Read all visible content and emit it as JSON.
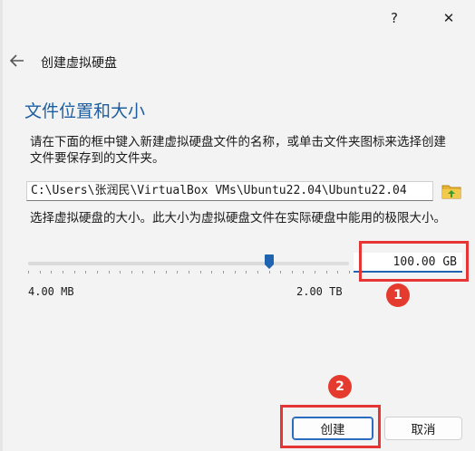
{
  "titlebar": {
    "help_label": "?",
    "close_label": "✕"
  },
  "header": {
    "title": "创建虚拟硬盘"
  },
  "section": {
    "title": "文件位置和大小"
  },
  "location": {
    "description": "请在下面的框中键入新建虚拟硬盘文件的名称，或单击文件夹图标来选择创建文件要保存到的文件夹。",
    "path_value": "C:\\Users\\张润民\\VirtualBox VMs\\Ubuntu22.04\\Ubuntu22.04"
  },
  "size": {
    "description": "选择虚拟硬盘的大小。此大小为虚拟硬盘文件在实际硬盘中能用的极限大小。",
    "min_label": "4.00 MB",
    "max_label": "2.00 TB",
    "value": "100.00 GB",
    "slider_fraction": 0.75
  },
  "annotations": {
    "badge1": "1",
    "badge2": "2"
  },
  "buttons": {
    "create_label": "创建",
    "cancel_label": "取消"
  },
  "colors": {
    "accent": "#1e64b0",
    "annotation": "#e53535",
    "section_title": "#1f5fa0"
  },
  "icons": {
    "back": "back-arrow-icon",
    "folder": "folder-icon",
    "close": "close-icon",
    "help": "help-icon"
  }
}
